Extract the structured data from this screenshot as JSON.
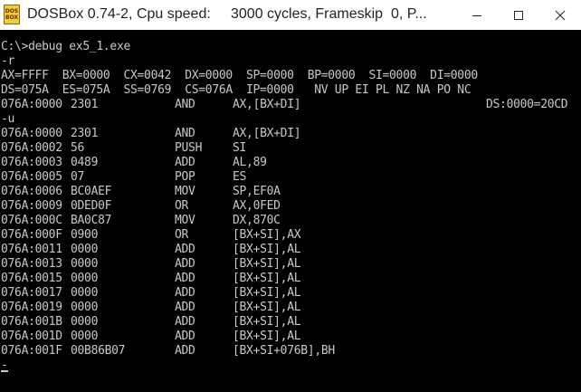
{
  "window": {
    "title": "DOSBox 0.74-2, Cpu speed:     3000 cycles, Frameskip  0, P...",
    "logo_top": "DOS",
    "logo_bottom": "BOX",
    "icons": {
      "minimize": "minimize-icon",
      "maximize": "maximize-icon",
      "close": "close-icon"
    },
    "titlebar_color": "#ffffff"
  },
  "console": {
    "command": "C:\\>debug ex5_1.exe",
    "r_cmd": "-r",
    "regs1": "AX=FFFF  BX=0000  CX=0042  DX=0000  SP=0000  BP=0000  SI=0000  DI=0000",
    "regs2": "DS=075A  ES=075A  SS=0769  CS=076A  IP=0000   NV UP EI PL NZ NA PO NC",
    "cur_addr": "076A:0000",
    "cur_bytes": "2301",
    "cur_mnemonic": "AND",
    "cur_operands": "AX,[BX+DI]",
    "cur_mem": "DS:0000=20CD",
    "u_cmd": "-u",
    "prompt": "-",
    "disasm": [
      {
        "addr": "076A:0000",
        "bytes": "2301",
        "mnemonic": "AND",
        "operands": "AX,[BX+DI]"
      },
      {
        "addr": "076A:0002",
        "bytes": "56",
        "mnemonic": "PUSH",
        "operands": "SI"
      },
      {
        "addr": "076A:0003",
        "bytes": "0489",
        "mnemonic": "ADD",
        "operands": "AL,89"
      },
      {
        "addr": "076A:0005",
        "bytes": "07",
        "mnemonic": "POP",
        "operands": "ES"
      },
      {
        "addr": "076A:0006",
        "bytes": "BC0AEF",
        "mnemonic": "MOV",
        "operands": "SP,EF0A"
      },
      {
        "addr": "076A:0009",
        "bytes": "0DED0F",
        "mnemonic": "OR",
        "operands": "AX,0FED"
      },
      {
        "addr": "076A:000C",
        "bytes": "BA0C87",
        "mnemonic": "MOV",
        "operands": "DX,870C"
      },
      {
        "addr": "076A:000F",
        "bytes": "0900",
        "mnemonic": "OR",
        "operands": "[BX+SI],AX"
      },
      {
        "addr": "076A:0011",
        "bytes": "0000",
        "mnemonic": "ADD",
        "operands": "[BX+SI],AL"
      },
      {
        "addr": "076A:0013",
        "bytes": "0000",
        "mnemonic": "ADD",
        "operands": "[BX+SI],AL"
      },
      {
        "addr": "076A:0015",
        "bytes": "0000",
        "mnemonic": "ADD",
        "operands": "[BX+SI],AL"
      },
      {
        "addr": "076A:0017",
        "bytes": "0000",
        "mnemonic": "ADD",
        "operands": "[BX+SI],AL"
      },
      {
        "addr": "076A:0019",
        "bytes": "0000",
        "mnemonic": "ADD",
        "operands": "[BX+SI],AL"
      },
      {
        "addr": "076A:001B",
        "bytes": "0000",
        "mnemonic": "ADD",
        "operands": "[BX+SI],AL"
      },
      {
        "addr": "076A:001D",
        "bytes": "0000",
        "mnemonic": "ADD",
        "operands": "[BX+SI],AL"
      },
      {
        "addr": "076A:001F",
        "bytes": "00B86B07",
        "mnemonic": "ADD",
        "operands": "[BX+SI+076B],BH"
      }
    ]
  }
}
